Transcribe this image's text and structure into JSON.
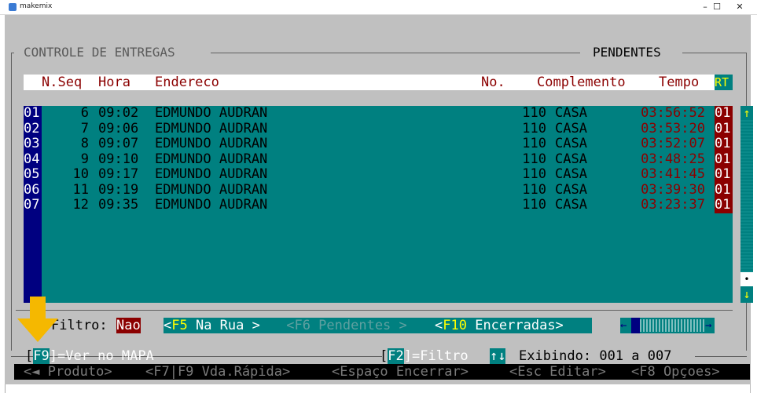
{
  "window": {
    "title": "makemix",
    "minimize": "–",
    "maximize": "☐",
    "close": "✕"
  },
  "frame": {
    "title_left": "CONTROLE DE ENTREGAS",
    "title_right": "PENDENTES"
  },
  "table": {
    "headers": {
      "seq": "N.Seq",
      "hora": "Hora",
      "endereco": "Endereco",
      "no": "No.",
      "complemento": "Complemento",
      "tempo": "Tempo",
      "rt": "RT"
    },
    "rows": [
      {
        "idx": "01",
        "seq": "6",
        "hora": "09:02",
        "endereco": "EDMUNDO AUDRAN",
        "no": "110",
        "comp": "CASA",
        "tempo": "03:56:52",
        "rt": "01"
      },
      {
        "idx": "02",
        "seq": "7",
        "hora": "09:06",
        "endereco": "EDMUNDO AUDRAN",
        "no": "110",
        "comp": "CASA",
        "tempo": "03:53:20",
        "rt": "01"
      },
      {
        "idx": "03",
        "seq": "8",
        "hora": "09:07",
        "endereco": "EDMUNDO AUDRAN",
        "no": "110",
        "comp": "CASA",
        "tempo": "03:52:07",
        "rt": "01"
      },
      {
        "idx": "04",
        "seq": "9",
        "hora": "09:10",
        "endereco": "EDMUNDO AUDRAN",
        "no": "110",
        "comp": "CASA",
        "tempo": "03:48:25",
        "rt": "01"
      },
      {
        "idx": "05",
        "seq": "10",
        "hora": "09:17",
        "endereco": "EDMUNDO AUDRAN",
        "no": "110",
        "comp": "CASA",
        "tempo": "03:41:45",
        "rt": "01"
      },
      {
        "idx": "06",
        "seq": "11",
        "hora": "09:19",
        "endereco": "EDMUNDO AUDRAN",
        "no": "110",
        "comp": "CASA",
        "tempo": "03:39:30",
        "rt": "01"
      },
      {
        "idx": "07",
        "seq": "12",
        "hora": "09:35",
        "endereco": "EDMUNDO AUDRAN",
        "no": "110",
        "comp": "CASA",
        "tempo": "03:23:37",
        "rt": "01"
      }
    ]
  },
  "scrollbar": {
    "up": "↑",
    "thumb": "•",
    "down": "↓"
  },
  "controls": {
    "filtro_label": "Filtro:",
    "filtro_value": "Nao",
    "tab_f5_open": "<",
    "tab_f5_key": "F5",
    "tab_f5_label": " Na Rua >",
    "tab_f6": " <F6 Pendentes > ",
    "tab_f10_open": "<",
    "tab_f10_key": "F10",
    "tab_f10_label": " Encerradas>",
    "hscroll_left": "←",
    "hscroll_right": "→",
    "f9_open": "[",
    "f9_key": "F9",
    "f9_label": "]=Ver no MAPA",
    "f2_open": "[",
    "f2_key": "F2",
    "f2_label": "]=Filtro",
    "updown": "↑↓",
    "exibindo": "Exibindo: 001 a 007"
  },
  "function_bar": {
    "produto": "<◄ Produto>",
    "vda_rapida": "<F7|F9 Vda.Rápida>",
    "encerrar": "<Espaço Encerrar>",
    "editar": "<Esc Editar>",
    "opcoes": "<F8 Opçoes>"
  },
  "colors": {
    "teal": "#008080",
    "navy": "#000080",
    "maroon": "#8b0000",
    "yellow": "#ffff00",
    "arrow": "#f5b800"
  }
}
